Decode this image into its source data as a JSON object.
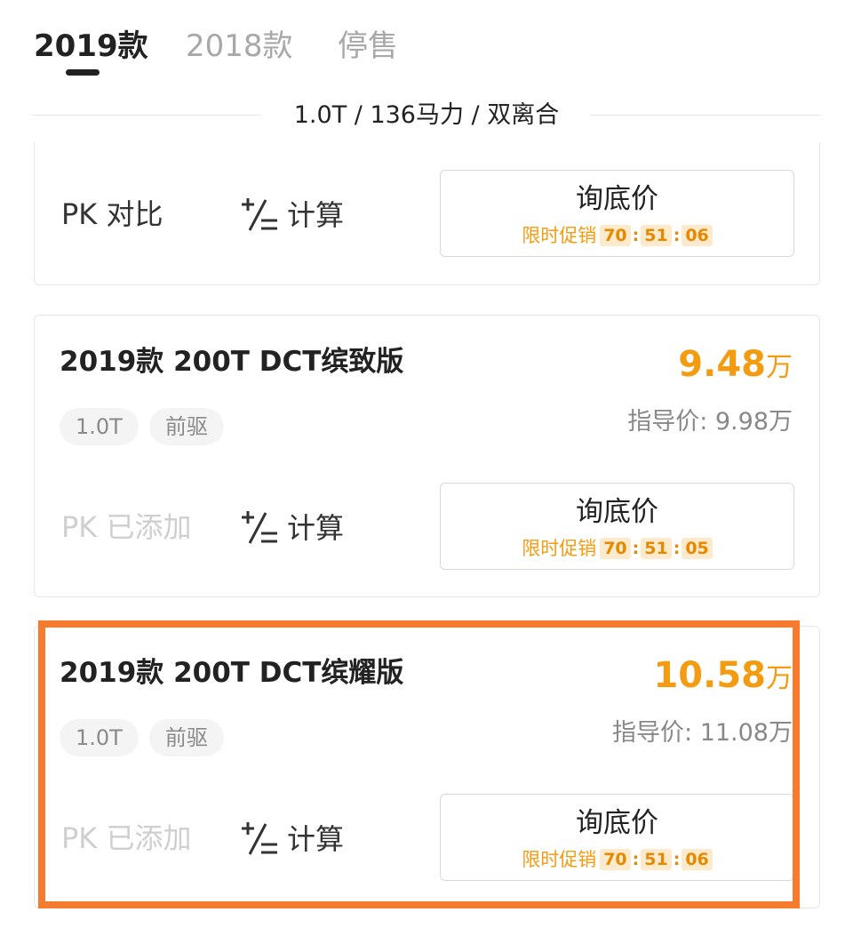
{
  "tabs": [
    {
      "label": "2019款",
      "active": true
    },
    {
      "label": "2018款",
      "active": false
    },
    {
      "label": "停售",
      "active": false
    }
  ],
  "section": {
    "label": "1.0T / 136马力 / 双离合"
  },
  "cards": [
    {
      "partial": true,
      "pk_label": "PK 对比",
      "calc_label": "计算",
      "inquiry_label": "询底价",
      "promo_label": "限时促销",
      "countdown": [
        "70",
        "51",
        "06"
      ]
    },
    {
      "name": "2019款 200T DCT缤致版",
      "price": "9.48",
      "price_unit": "万",
      "guide_price": "指导价: 9.98万",
      "tags": [
        "1.0T",
        "前驱"
      ],
      "pk_label": "PK 已添加",
      "calc_label": "计算",
      "inquiry_label": "询底价",
      "promo_label": "限时促销",
      "countdown": [
        "70",
        "51",
        "05"
      ]
    },
    {
      "name": "2019款 200T DCT缤耀版",
      "price": "10.58",
      "price_unit": "万",
      "guide_price": "指导价: 11.08万",
      "tags": [
        "1.0T",
        "前驱"
      ],
      "pk_label": "PK 已添加",
      "calc_label": "计算",
      "inquiry_label": "询底价",
      "promo_label": "限时促销",
      "countdown": [
        "70",
        "51",
        "06"
      ]
    }
  ],
  "colors": {
    "accent": "#f39c12",
    "highlight": "#f57b2e"
  },
  "icons": {
    "calc": "plus-minus-calc-icon"
  }
}
